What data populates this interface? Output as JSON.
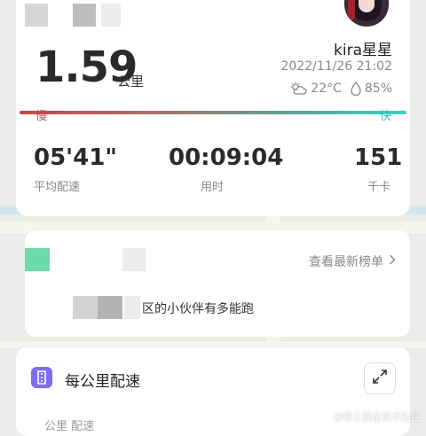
{
  "summary": {
    "distance": "1.59",
    "distance_unit": "公里",
    "username": "kira星星",
    "datetime": "2022/11/26 21:02",
    "temperature": "22°C",
    "humidity": "85%"
  },
  "pace_scale": {
    "slow_label": "慢",
    "fast_label": "快"
  },
  "stats": [
    {
      "value": "05'41\"",
      "label": "平均配速"
    },
    {
      "value": "00:09:04",
      "label": "用时"
    },
    {
      "value": "151",
      "label": "千卡"
    }
  ],
  "ranking": {
    "link_label": "查看最新榜单",
    "community_text": "区的小伙伴有多能跑"
  },
  "pace_section": {
    "title": "每公里配速",
    "subtitle": "公里   配速"
  },
  "watermark": "@稀土掘金技术社区",
  "colors": {
    "slow": "#c8464a",
    "fast": "#2fc4b8",
    "accent_purple": "#7c6cf0",
    "accent_green": "#6cd9a8"
  },
  "icons": [
    "weather-cloud-sun-icon",
    "humidity-drop-icon",
    "chevron-right-icon",
    "pace-icon",
    "expand-icon"
  ]
}
